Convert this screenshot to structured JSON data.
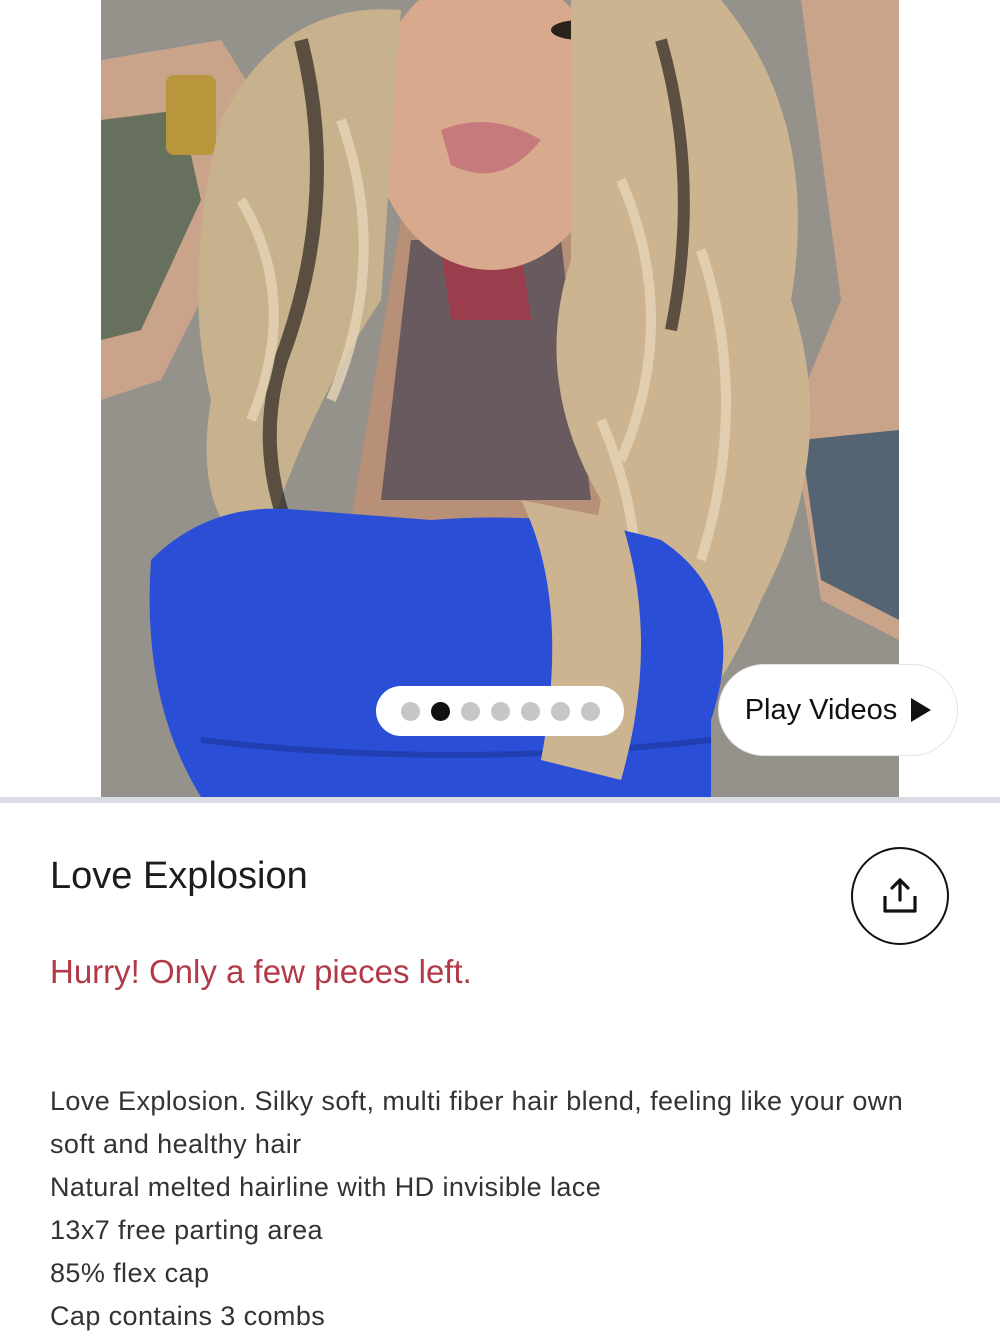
{
  "gallery": {
    "slide_count": 7,
    "active_slide_index": 1,
    "play_videos_label": "Play Videos"
  },
  "product": {
    "title": "Love Explosion",
    "urgency_message": "Hurry! Only a few pieces left.",
    "description_lines": [
      "Love Explosion. Silky soft, multi fiber hair blend, feeling like your own soft and healthy hair",
      "Natural melted hairline with HD invisible lace",
      "13x7 free parting area",
      "85% flex cap",
      "Cap contains 3 combs"
    ]
  },
  "icons": {
    "share": "share-upload-icon",
    "play": "play-triangle-icon"
  },
  "colors": {
    "urgency": "#b23a48",
    "active_dot": "#111111",
    "inactive_dot": "#c6c6c6",
    "top_color": "#2a4fd6"
  }
}
